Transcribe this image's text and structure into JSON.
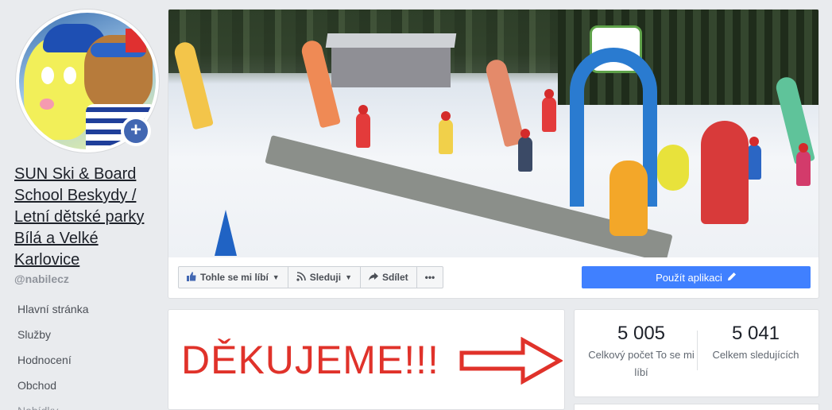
{
  "profile": {
    "name": "SUN Ski & Board School Beskydy / Letní dětské parky Bílá a Velké Karlovice",
    "handle": "@nabilecz",
    "add_icon": "plus-icon"
  },
  "left_nav": {
    "items": [
      {
        "label": "Hlavní stránka"
      },
      {
        "label": "Služby"
      },
      {
        "label": "Hodnocení"
      },
      {
        "label": "Obchod"
      },
      {
        "label": "Nabídky"
      }
    ]
  },
  "cover_actions": {
    "like_label": "Tohle se mi líbí",
    "follow_label": "Sleduji",
    "share_label": "Sdílet",
    "more_label": "•••",
    "use_app_label": "Použít aplikaci"
  },
  "post": {
    "text": "DĚKUJEME!!!"
  },
  "stats": {
    "likes_count": "5 005",
    "likes_label": "Celkový počet To se mi líbí",
    "followers_count": "5 041",
    "followers_label": "Celkem sledujících"
  },
  "colors": {
    "accent": "#4080ff",
    "brand": "#4267b2",
    "post_text": "#e0322a"
  }
}
